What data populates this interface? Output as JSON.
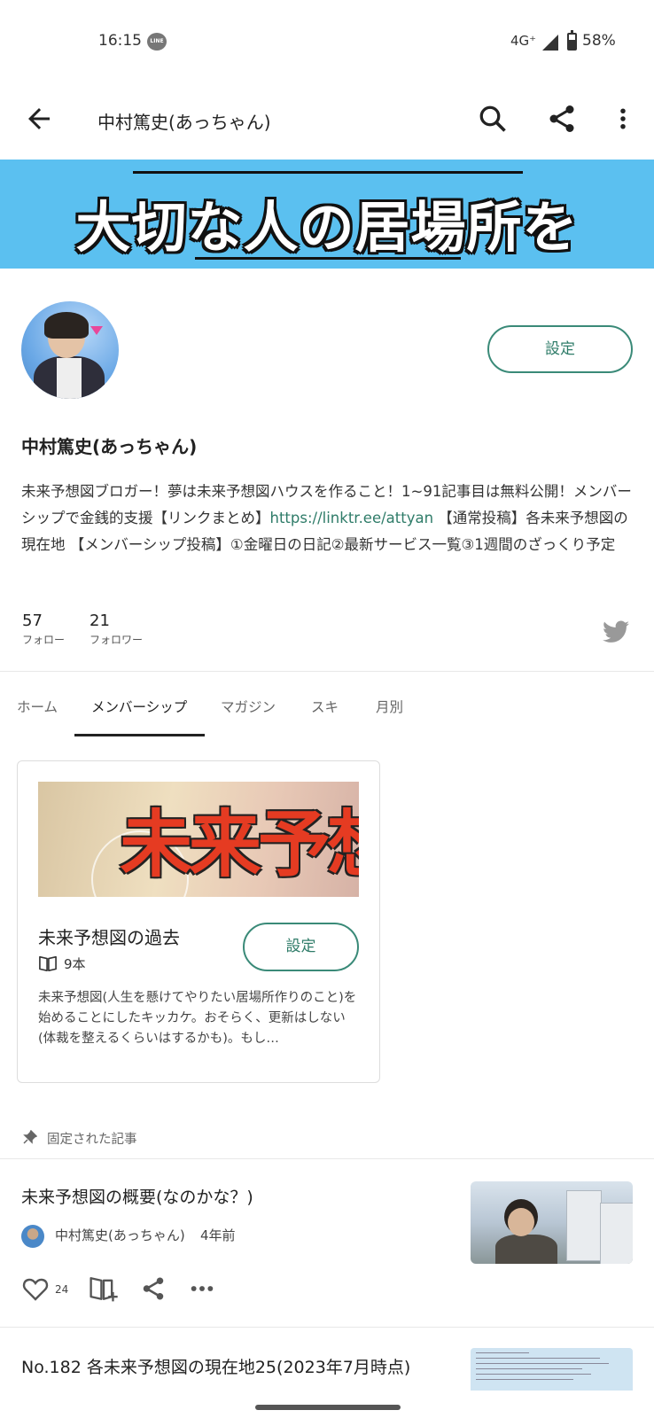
{
  "status_bar": {
    "time": "16:15",
    "line_badge": "LINE",
    "network": "4G⁺",
    "battery": "58%"
  },
  "app_bar": {
    "title": "中村篤史(あっちゃん)"
  },
  "banner": {
    "text": "大切な人の居場所を",
    "bg_color": "#5bc0f0"
  },
  "profile": {
    "settings_label": "設定",
    "name": "中村篤史(あっちゃん)",
    "bio_before_link": "未来予想図ブロガー！夢は未来予想図ハウスを作ること！1~91記事目は無料公開！メンバーシップで金銭的支援【リンクまとめ】",
    "bio_link": "https://linktr.ee/attyan",
    "bio_after_link": " 【通常投稿】各未来予想図の現在地 【メンバーシップ投稿】①金曜日の日記②最新サービス一覧③1週間のざっくり予定",
    "follow_count": "57",
    "follow_label": "フォロー",
    "follower_count": "21",
    "follower_label": "フォロワー"
  },
  "tabs": [
    {
      "label": "ホーム",
      "active": false
    },
    {
      "label": "メンバーシップ",
      "active": true
    },
    {
      "label": "マガジン",
      "active": false
    },
    {
      "label": "スキ",
      "active": false
    },
    {
      "label": "月別",
      "active": false
    }
  ],
  "membership_card": {
    "image_text": "未来予想図",
    "title": "未来予想図の過去",
    "count": "9本",
    "settings_label": "設定",
    "description": "未来予想図(人生を懸けてやりたい居場所作りのこと)を始めることにしたキッカケ。おそらく、更新はしない(体裁を整えるくらいはするかも)。もし…"
  },
  "pinned": {
    "label": "固定された記事"
  },
  "articles": [
    {
      "title": "未来予想図の概要(なのかな？)",
      "author": "中村篤史(あっちゃん)",
      "time": "4年前",
      "likes": "24"
    },
    {
      "title": "No.182 各未来予想図の現在地25(2023年7月時点)"
    }
  ],
  "colors": {
    "accent": "#2f7c69",
    "banner": "#5bc0f0",
    "twitter": "#999999"
  }
}
